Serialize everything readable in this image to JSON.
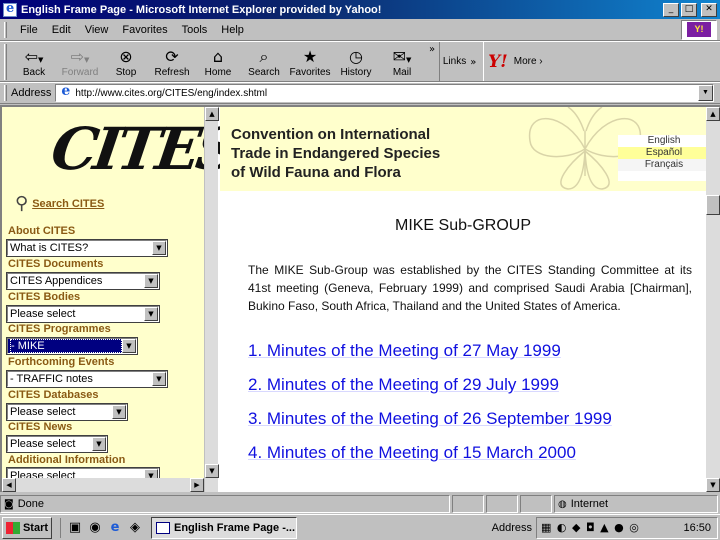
{
  "window": {
    "title": "English Frame Page - Microsoft Internet Explorer provided by Yahoo!"
  },
  "menu": {
    "items": [
      "File",
      "Edit",
      "View",
      "Favorites",
      "Tools",
      "Help"
    ]
  },
  "toolbar": {
    "buttons": [
      {
        "label": "Back",
        "icon": "back-arrow-icon"
      },
      {
        "label": "Forward",
        "icon": "forward-arrow-icon"
      },
      {
        "label": "Stop",
        "icon": "stop-icon"
      },
      {
        "label": "Refresh",
        "icon": "refresh-icon"
      },
      {
        "label": "Home",
        "icon": "home-icon"
      },
      {
        "label": "Search",
        "icon": "search-icon"
      },
      {
        "label": "Favorites",
        "icon": "favorites-icon"
      },
      {
        "label": "History",
        "icon": "history-icon"
      },
      {
        "label": "Mail",
        "icon": "mail-icon"
      }
    ],
    "links_label": "Links",
    "yahoo_more": "More ›"
  },
  "address": {
    "label": "Address",
    "url": "http://www.cites.org/CITES/eng/index.shtml"
  },
  "left_nav": {
    "logo_text": "CITES",
    "search_label": "Search CITES",
    "sections": [
      {
        "label": "About CITES",
        "value": "What is CITES?"
      },
      {
        "label": "CITES Documents",
        "value": "CITES Appendices"
      },
      {
        "label": "CITES Bodies",
        "value": "Please select"
      },
      {
        "label": "CITES Programmes",
        "value": "- MIKE"
      },
      {
        "label": "Forthcoming Events",
        "value": "- TRAFFIC notes"
      },
      {
        "label": "CITES Databases",
        "value": "Please select"
      },
      {
        "label": "CITES News",
        "value": "Please select"
      },
      {
        "label": "Additional Information",
        "value": "Please select"
      }
    ]
  },
  "header": {
    "title_lines": [
      "Convention on International",
      "Trade in Endangered Species",
      "of Wild Fauna and Flora"
    ],
    "languages": [
      "English",
      "Español",
      "Français"
    ]
  },
  "main": {
    "heading": "MIKE Sub-GROUP",
    "paragraph": "The MIKE Sub-Group was established by the CITES Standing Committee at its 41st meeting (Geneva, February 1999) and comprised Saudi Arabia [Chairman], Bukino Faso, South Africa, Thailand and the United States of America.",
    "minutes": [
      "1. Minutes of  the Meeting of 27 May 1999",
      "2. Minutes of  the Meeting of 29 July 1999",
      "3. Minutes of  the Meeting of 26 September 1999",
      "4. Minutes of  the Meeting of 15 March 2000"
    ]
  },
  "status": {
    "text": "Done",
    "zone": "Internet"
  },
  "taskbar": {
    "start": "Start",
    "task": "English Frame Page -...",
    "address_label": "Address",
    "clock": "16:50"
  },
  "colors": {
    "nav_label": "#8a5a14",
    "link": "#1010e0",
    "left_bg": "#ffffcc",
    "title_bar": "#00007b"
  }
}
